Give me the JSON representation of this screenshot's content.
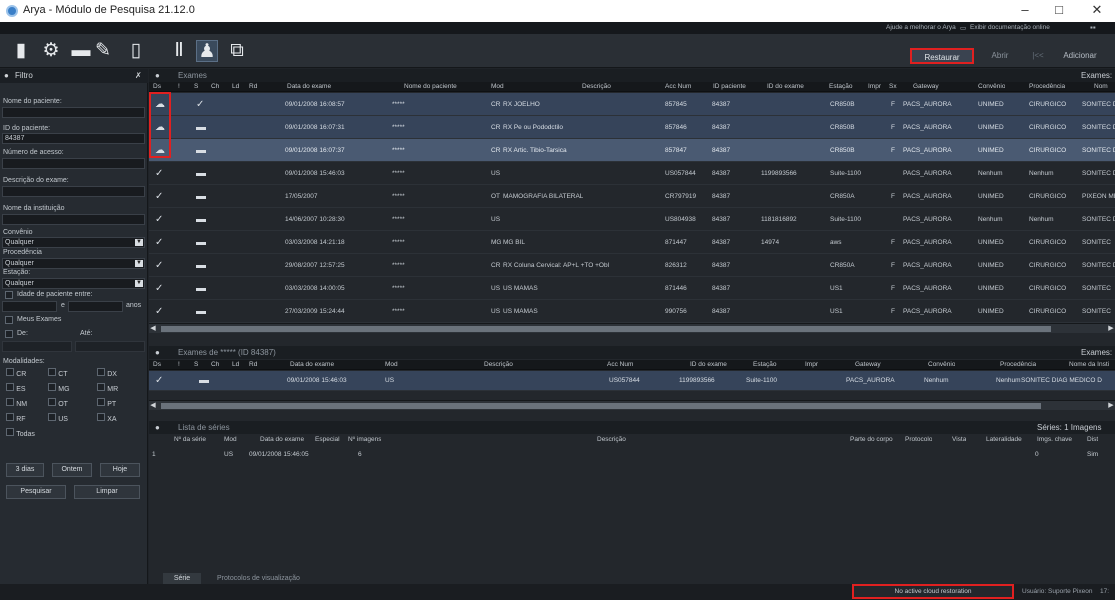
{
  "window": {
    "title": "Arya - Módulo de Pesquisa 21.12.0",
    "minimize": "–",
    "maximize": "□",
    "close": "✕"
  },
  "topstrip": {
    "help": "Ajude a melhorar o Arya",
    "docs": "Exibir documentação online",
    "grid": "▪▪"
  },
  "toolbar": {
    "icons": [
      "document-icon",
      "settings-icon",
      "minus-icon",
      "user-settings-icon",
      "tablet-icon",
      "tools-icon",
      "user-icon",
      "export-icon"
    ],
    "restaurar": "Restaurar",
    "abrir": "Abrir",
    "sep": "|<<",
    "adicionar": "Adicionar"
  },
  "sidebar": {
    "title": "Filtro",
    "pin": "✗",
    "patient_name_label": "Nome do paciente:",
    "patient_name_value": "",
    "patient_id_label": "ID do paciente:",
    "patient_id_value": "84387",
    "access_label": "Número de acesso:",
    "access_value": "",
    "desc_label": "Descrição do exame:",
    "desc_value": "",
    "inst_label": "Nome da instituição",
    "inst_value": "",
    "convenio_label": "Convênio",
    "convenio_value": "Qualquer",
    "procedencia_label": "Procedência",
    "procedencia_value": "Qualquer",
    "estacao_label": "Estação:",
    "estacao_value": "Qualquer",
    "age_label": "Idade de paciente entre:",
    "age_e": "e",
    "age_anos": "anos",
    "meus_exames": "Meus Exames",
    "de_label": "De:",
    "ate_label": "Até:",
    "modalidades_label": "Modalidades:",
    "modalities": [
      "CR",
      "CT",
      "DX",
      "ES",
      "MG",
      "MR",
      "NM",
      "OT",
      "PT",
      "RF",
      "US",
      "XA"
    ],
    "todas": "Todas",
    "btn_3dias": "3 dias",
    "btn_ontem": "Ontem",
    "btn_hoje": "Hoje",
    "btn_pesquisar": "Pesquisar",
    "btn_limpar": "Limpar"
  },
  "exams": {
    "title": "Exames",
    "count": "Exames:",
    "headers": [
      "Ds",
      "!",
      "S",
      "Ch",
      "Ld",
      "Rd",
      "Data do exame",
      "Nome do paciente",
      "Mod",
      "Descrição",
      "Acc Num",
      "ID paciente",
      "ID do exame",
      "Estação",
      "Impr",
      "Sx",
      "Gateway",
      "Convênio",
      "Procedência",
      "Nom"
    ],
    "rows": [
      {
        "ds": "cloud",
        "s": "check",
        "date": "09/01/2008 16:08:57",
        "name": "*****",
        "mod": "CR",
        "desc": "RX JOELHO",
        "acc": "857845",
        "pid": "84387",
        "eid": "",
        "est": "CR850B",
        "impr": "",
        "sx": "F",
        "gw": "PACS_AURORA",
        "conv": "UNIMED",
        "proc": "CIRURGICO",
        "nome": "SONITEC DIA"
      },
      {
        "ds": "cloud",
        "s": "folder",
        "date": "09/01/2008 16:07:31",
        "name": "*****",
        "mod": "CR",
        "desc": "RX Pe ou Pododctilo",
        "acc": "857846",
        "pid": "84387",
        "eid": "",
        "est": "CR850B",
        "impr": "",
        "sx": "F",
        "gw": "PACS_AURORA",
        "conv": "UNIMED",
        "proc": "CIRURGICO",
        "nome": "SONITEC DIA"
      },
      {
        "ds": "cloud",
        "s": "folder",
        "date": "09/01/2008 16:07:37",
        "name": "*****",
        "mod": "CR",
        "desc": "RX Artic. Tibio-Tarsica",
        "acc": "857847",
        "pid": "84387",
        "eid": "",
        "est": "CR850B",
        "impr": "",
        "sx": "F",
        "gw": "PACS_AURORA",
        "conv": "UNIMED",
        "proc": "CIRURGICO",
        "nome": "SONITEC DIA"
      },
      {
        "ds": "check",
        "s": "folder",
        "date": "09/01/2008 15:46:03",
        "name": "*****",
        "mod": "US",
        "desc": "",
        "acc": "US057844",
        "pid": "84387",
        "eid": "1199893566",
        "est": "Suite-1100",
        "impr": "",
        "sx": "",
        "gw": "PACS_AURORA",
        "conv": "Nenhum",
        "proc": "Nenhum",
        "nome": "SONITEC DIA"
      },
      {
        "ds": "check",
        "s": "folder",
        "date": "17/05/2007",
        "name": "*****",
        "mod": "OT",
        "desc": "MAMOGRAFIA BILATERAL",
        "acc": "CR797919",
        "pid": "84387",
        "eid": "",
        "est": "CR850A",
        "impr": "",
        "sx": "F",
        "gw": "PACS_AURORA",
        "conv": "UNIMED",
        "proc": "CIRURGICO",
        "nome": "PIXEON MED"
      },
      {
        "ds": "check",
        "s": "folder",
        "date": "14/06/2007 10:28:30",
        "name": "*****",
        "mod": "US",
        "desc": "",
        "acc": "US804938",
        "pid": "84387",
        "eid": "1181816892",
        "est": "Suite-1100",
        "impr": "",
        "sx": "",
        "gw": "PACS_AURORA",
        "conv": "Nenhum",
        "proc": "Nenhum",
        "nome": "SONITEC DIA"
      },
      {
        "ds": "check",
        "s": "folder",
        "date": "03/03/2008 14:21:18",
        "name": "*****",
        "mod": "MG",
        "desc": "MG BIL",
        "acc": "871447",
        "pid": "84387",
        "eid": "14974",
        "est": "aws",
        "impr": "",
        "sx": "F",
        "gw": "PACS_AURORA",
        "conv": "UNIMED",
        "proc": "CIRURGICO",
        "nome": "SONITEC"
      },
      {
        "ds": "check",
        "s": "folder",
        "date": "29/08/2007 12:57:25",
        "name": "*****",
        "mod": "CR",
        "desc": "RX Coluna Cervical: AP+L +TO +Obl",
        "acc": "826312",
        "pid": "84387",
        "eid": "",
        "est": "CR850A",
        "impr": "",
        "sx": "F",
        "gw": "PACS_AURORA",
        "conv": "UNIMED",
        "proc": "CIRURGICO",
        "nome": "SONITEC DIA"
      },
      {
        "ds": "check",
        "s": "folder",
        "date": "03/03/2008 14:00:05",
        "name": "*****",
        "mod": "US",
        "desc": "US MAMAS",
        "acc": "871446",
        "pid": "84387",
        "eid": "",
        "est": "US1",
        "impr": "",
        "sx": "F",
        "gw": "PACS_AURORA",
        "conv": "UNIMED",
        "proc": "CIRURGICO",
        "nome": "SONITEC"
      },
      {
        "ds": "check",
        "s": "folder",
        "date": "27/03/2009 15:24:44",
        "name": "*****",
        "mod": "US",
        "desc": "US MAMAS",
        "acc": "990756",
        "pid": "84387",
        "eid": "",
        "est": "US1",
        "impr": "",
        "sx": "F",
        "gw": "PACS_AURORA",
        "conv": "UNIMED",
        "proc": "CIRURGICO",
        "nome": "SONITEC"
      }
    ]
  },
  "patient_exams": {
    "title": "Exames de ***** (ID 84387)",
    "count": "Exames:",
    "headers": [
      "Ds",
      "!",
      "S",
      "Ch",
      "Ld",
      "Rd",
      "Data do exame",
      "Mod",
      "Descrição",
      "Acc Num",
      "ID do exame",
      "Estação",
      "Impr",
      "Gateway",
      "Convênio",
      "Procedência",
      "Nome da Insti"
    ],
    "row": {
      "date": "09/01/2008 15:46:03",
      "mod": "US",
      "desc": "",
      "acc": "US057844",
      "eid": "1199893566",
      "est": "Suite-1100",
      "impr": "",
      "gw": "PACS_AURORA",
      "conv": "Nenhum",
      "proc": "Nenhum",
      "nome": "SONITEC DIAG MEDICO D"
    }
  },
  "series": {
    "title": "Lista de séries",
    "count": "Séries: 1 Imagens",
    "headers": [
      "Nº da série",
      "Mod",
      "Data do exame",
      "Especial",
      "Nº imagens",
      "Descrição",
      "Parte do corpo",
      "Protocolo",
      "Vista",
      "Lateralidade",
      "Imgs. chave",
      "Dist"
    ],
    "row": {
      "num": "1",
      "mod": "US",
      "date": "09/01/2008 15:46:05",
      "especial": "",
      "imgs": "6",
      "desc": "",
      "parte": "",
      "prot": "",
      "vista": "",
      "lat": "",
      "chave": "0",
      "dist": "Sim"
    }
  },
  "tabs": {
    "serie": "Série",
    "protocolos": "Protocolos de visualização"
  },
  "status": {
    "cloud": "No active cloud restoration",
    "user": "Usuário: Suporte Pixeon",
    "extra": "17:"
  },
  "colors": {
    "highlight": "#e02020",
    "selected": "#36445a"
  }
}
